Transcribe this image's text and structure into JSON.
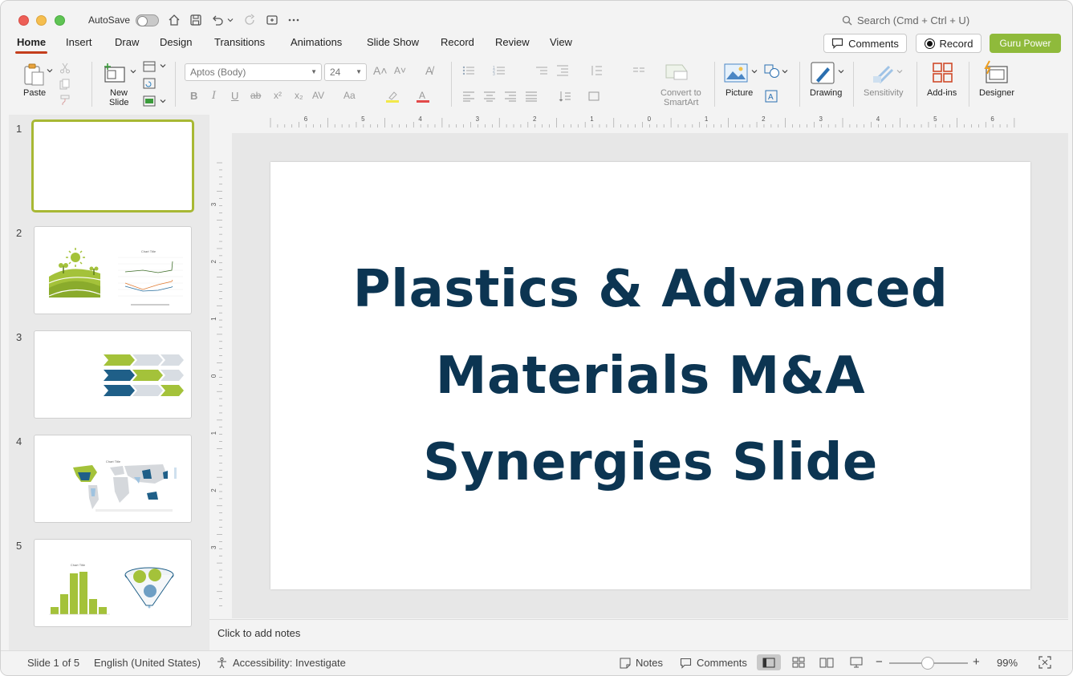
{
  "titlebar": {
    "autosave_label": "AutoSave",
    "search_placeholder": "Search (Cmd + Ctrl + U)"
  },
  "tabs": [
    {
      "label": "Home"
    },
    {
      "label": "Insert"
    },
    {
      "label": "Draw"
    },
    {
      "label": "Design"
    },
    {
      "label": "Transitions"
    },
    {
      "label": "Animations"
    },
    {
      "label": "Slide Show"
    },
    {
      "label": "Record"
    },
    {
      "label": "Review"
    },
    {
      "label": "View"
    }
  ],
  "header_buttons": {
    "comments": "Comments",
    "record": "Record",
    "guru": "Guru Power"
  },
  "ribbon": {
    "paste": "Paste",
    "new_slide_line1": "New",
    "new_slide_line2": "Slide",
    "font_name": "Aptos (Body)",
    "font_size": "24",
    "convert_line1": "Convert to",
    "convert_line2": "SmartArt",
    "picture": "Picture",
    "drawing": "Drawing",
    "sensitivity": "Sensitivity",
    "addins": "Add-ins",
    "designer": "Designer"
  },
  "slides": [
    {
      "number": "1"
    },
    {
      "number": "2",
      "chart_title": "Chart Title"
    },
    {
      "number": "3"
    },
    {
      "number": "4",
      "chart_title": "Chart Title"
    },
    {
      "number": "5",
      "chart_title": "Chart Title"
    }
  ],
  "current_slide": {
    "title_line1": "Plastics & Advanced",
    "title_line2": "Materials M&A",
    "title_line3": "Synergies Slide",
    "title_color": "#0c3552"
  },
  "notes": {
    "placeholder": "Click to add notes"
  },
  "status": {
    "slide_counter": "Slide 1 of 5",
    "language": "English (United States)",
    "accessibility": "Accessibility: Investigate",
    "notes": "Notes",
    "comments": "Comments",
    "zoom": "99%"
  },
  "ruler_h": [
    "6",
    "5",
    "4",
    "3",
    "2",
    "1",
    "0",
    "1",
    "2",
    "3",
    "4",
    "5",
    "6"
  ],
  "ruler_v": [
    "3",
    "2",
    "1",
    "0",
    "1",
    "2",
    "3"
  ],
  "colors": {
    "accent_tab": "#c43e1c",
    "guru": "#8fba3b",
    "thumb_select": "#a8b834"
  }
}
